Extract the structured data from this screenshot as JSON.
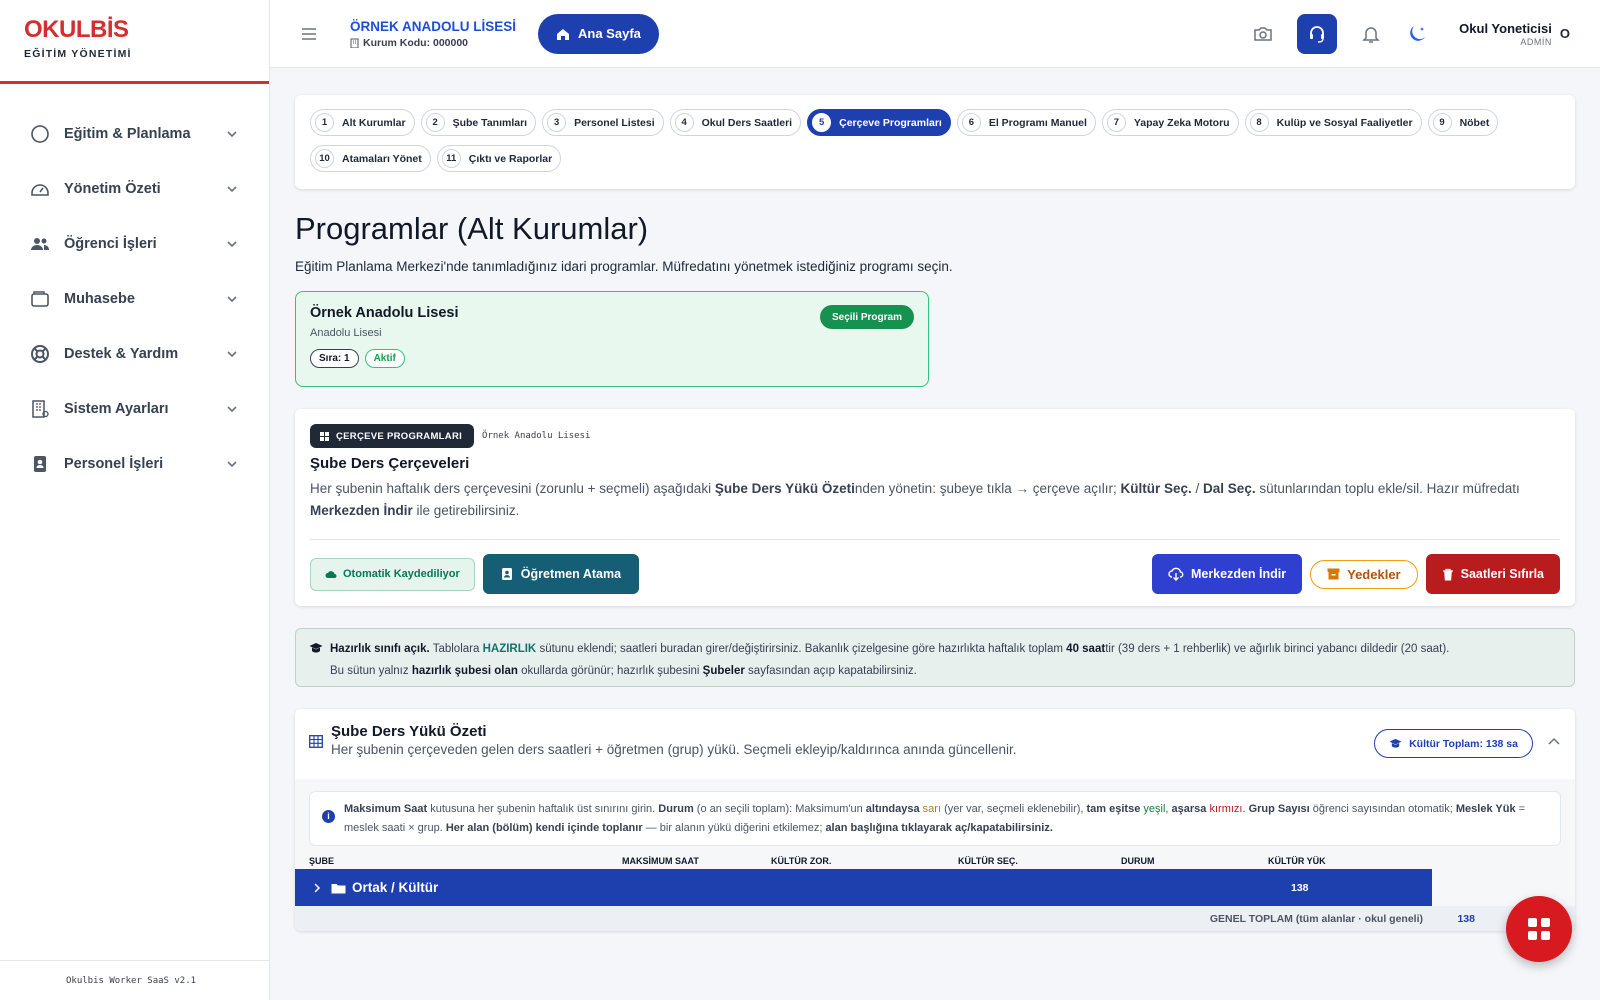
{
  "brand": {
    "name": "OKULBİS",
    "subtitle": "EĞİTİM YÖNETİMİ"
  },
  "sidebar": {
    "items": [
      {
        "label": "Eğitim & Planlama",
        "icon": "circle-icon"
      },
      {
        "label": "Yönetim Özeti",
        "icon": "dashboard-gauge-icon"
      },
      {
        "label": "Öğrenci İşleri",
        "icon": "users-icon"
      },
      {
        "label": "Muhasebe",
        "icon": "wallet-icon"
      },
      {
        "label": "Destek & Yardım",
        "icon": "lifebuoy-icon"
      },
      {
        "label": "Sistem Ayarları",
        "icon": "building-icon"
      },
      {
        "label": "Personel İşleri",
        "icon": "id-badge-icon"
      }
    ],
    "footer": "Okulbis Worker SaaS v2.1"
  },
  "header": {
    "school_name": "ÖRNEK ANADOLU LİSESİ",
    "school_code": "Kurum Kodu: 000000",
    "home_label": "Ana Sayfa",
    "user_name": "Okul Yoneticisi",
    "user_role": "ADMİN",
    "user_initial": "O"
  },
  "steps": [
    {
      "num": "1",
      "label": "Alt Kurumlar"
    },
    {
      "num": "2",
      "label": "Şube Tanımları"
    },
    {
      "num": "3",
      "label": "Personel Listesi"
    },
    {
      "num": "4",
      "label": "Okul Ders Saatleri"
    },
    {
      "num": "5",
      "label": "Çerçeve Programları",
      "active": true
    },
    {
      "num": "6",
      "label": "El Programı Manuel"
    },
    {
      "num": "7",
      "label": "Yapay Zeka Motoru"
    },
    {
      "num": "8",
      "label": "Kulüp ve Sosyal Faaliyetler"
    },
    {
      "num": "9",
      "label": "Nöbet"
    },
    {
      "num": "10",
      "label": "Atamaları Yönet"
    },
    {
      "num": "11",
      "label": "Çıktı ve Raporlar"
    }
  ],
  "page": {
    "title": "Programlar (Alt Kurumlar)",
    "description": "Eğitim Planlama Merkezi'nde tanımladığınız idari programlar. Müfredatını yönetmek istediğiniz programı seçin."
  },
  "program_card": {
    "title": "Örnek Anadolu Lisesi",
    "subtitle": "Anadolu Lisesi",
    "badge": "Seçili Program",
    "order_tag": "Sıra: 1",
    "status_tag": "Aktif"
  },
  "frame": {
    "badge": "ÇERÇEVE PROGRAMLARI",
    "school": "Örnek Anadolu Lisesi",
    "title": "Şube Ders Çerçeveleri",
    "desc_1": "Her şubenin haftalık ders çerçevesini (zorunlu + seçmeli) aşağıdaki ",
    "desc_b1": "Şube Ders Yükü Özeti",
    "desc_2": "nden yönetin: şubeye tıkla → çerçeve açılır; ",
    "desc_b2": "Kültür Seç.",
    "desc_3": " / ",
    "desc_b3": "Dal Seç.",
    "desc_4": " sütunlarından toplu ekle/sil. Hazır müfredatı ",
    "desc_b4": "Merkezden İndir",
    "desc_5": " ile getirebilirsiniz.",
    "auto_save": "Otomatik Kaydediliyor",
    "teacher_btn": "Öğretmen Atama",
    "central_btn": "Merkezden İndir",
    "backup_btn": "Yedekler",
    "reset_btn": "Saatleri Sıfırla"
  },
  "info": {
    "lead": "Hazırlık sınıfı açık.",
    "t1": " Tablolara ",
    "hl": "HAZIRLIK",
    "t2": " sütunu eklendi; saatleri buradan girer/değiştirirsiniz. Bakanlık çizelgesine göre hazırlıkta haftalık toplam ",
    "b1": "40 saat",
    "t3": "tir (39 ders + 1 rehberlik) ve ağırlık birinci yabancı dildedir (20 saat).",
    "t4": "Bu sütun yalnız ",
    "b2": "hazırlık şubesi olan",
    "t5": " okullarda görünür; hazırlık şubesini ",
    "b3": "Şubeler",
    "t6": " sayfasından açıp kapatabilirsiniz."
  },
  "load": {
    "title": "Şube Ders Yükü Özeti",
    "desc": "Her şubenin çerçeveden gelen ders saatleri + öğretmen (grup) yükü. Seçmeli ekleyip/kaldırınca anında güncellenir.",
    "kultur_badge": "Kültür Toplam: 138 sa",
    "note": {
      "b1": "Maksimum Saat",
      "t1": " kutusuna her şubenin haftalık üst sınırını girin. ",
      "b2": "Durum",
      "t2": " (o an seçili toplam): Maksimum'un ",
      "b3": "altındaysa",
      "yellow": "sarı",
      "t3": " (yer var, seçmeli eklenebilir), ",
      "b4": "tam eşitse",
      "green": "yeşil",
      "t4": ", ",
      "b5": "aşarsa",
      "red": "kırmızı",
      "t5": ". ",
      "b6": "Grup Sayısı",
      "t6": " öğrenci sayısından otomatik; ",
      "b7": "Meslek Yük",
      "t7": " = meslek saati × grup. ",
      "b8": "Her alan (bölüm) kendi içinde toplanır",
      "t8": " — bir alanın yükü diğerini etkilemez; ",
      "b9": "alan başlığına tıklayarak aç/kapatabilirsiniz."
    },
    "columns": [
      "ŞUBE",
      "MAKSİMUM SAAT",
      "KÜLTÜR ZOR.",
      "KÜLTÜR SEÇ.",
      "DURUM",
      "KÜLTÜR YÜK"
    ],
    "group_row": {
      "name": "Ortak / Kültür",
      "kultur_yuk": "138"
    },
    "footer_label": "GENEL TOPLAM (tüm alanlar · okul geneli)",
    "footer_value": "138"
  },
  "colors": {
    "brand_red": "#d32f2f",
    "primary_blue": "#1e40af",
    "success_green": "#15924f",
    "danger_red": "#b91c1c",
    "warning_amber": "#f59e0b"
  }
}
